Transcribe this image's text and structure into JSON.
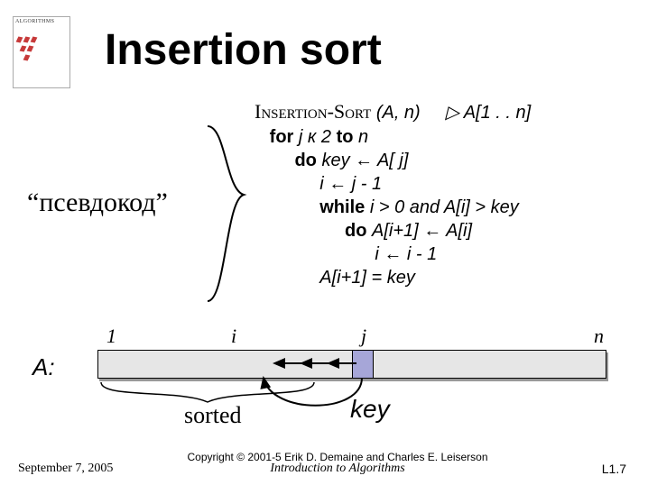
{
  "logo": {
    "text": "ALGORITHMS"
  },
  "title": "Insertion sort",
  "pseudocode_label": "“псевдокод”",
  "code": {
    "l1_smallcaps": "Insertion-Sort",
    "l1_rest": " (A, n)",
    "l1_comment": "▷ A[1 . . n]",
    "l2_a": "for ",
    "l2_b": "j к 2",
    "l2_c": " to ",
    "l2_d": "n",
    "l3_a": "do ",
    "l3_b": "key ← A[ j]",
    "l4": "i ← j - 1",
    "l5_a": "while ",
    "l5_b": "i > 0 and A[i] > key",
    "l6_a": "do ",
    "l6_b": "A[i+1] ← A[i]",
    "l7": "i ← i - 1",
    "l8": "A[i+1] = key"
  },
  "indices": {
    "one": "1",
    "i": "i",
    "j": "j",
    "n": "n"
  },
  "array_label": "A:",
  "sorted_label": "sorted",
  "key_label": "key",
  "footer": {
    "date": "September 7, 2005",
    "copyright": "Copyright © 2001-5 Erik D. Demaine and Charles E. Leiserson",
    "intro": "Introduction to Algorithms",
    "page": "L1.7"
  }
}
